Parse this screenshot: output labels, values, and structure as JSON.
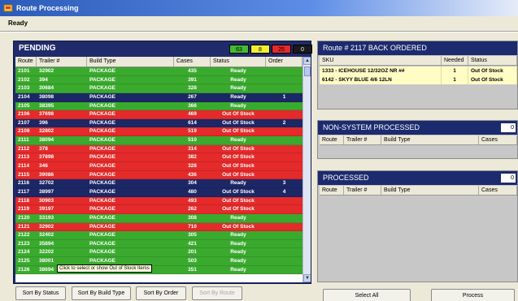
{
  "window": {
    "title": "Route Processing",
    "status": "Ready"
  },
  "pending": {
    "title": "PENDING",
    "counts": [
      {
        "value": "63",
        "color": "#44bb33"
      },
      {
        "value": "8",
        "color": "#f4ee33"
      },
      {
        "value": "25",
        "color": "#e42a2a"
      },
      {
        "value": "0",
        "color": "#1a1a1a"
      }
    ],
    "columns": {
      "route": "Route",
      "trailer": "Trailer #",
      "build": "Build Type",
      "cases": "Cases",
      "status": "Status",
      "order": "Order"
    },
    "rows": [
      {
        "route": "2101",
        "trailer": "32902",
        "build": "PACKAGE",
        "cases": "435",
        "status": "Ready",
        "order": "",
        "state": "ready"
      },
      {
        "route": "2102",
        "trailer": "394",
        "build": "PACKAGE",
        "cases": "391",
        "status": "Ready",
        "order": "",
        "state": "ready"
      },
      {
        "route": "2103",
        "trailer": "30684",
        "build": "PACKAGE",
        "cases": "328",
        "status": "Ready",
        "order": "",
        "state": "ready"
      },
      {
        "route": "2104",
        "trailer": "38098",
        "build": "PACKAGE",
        "cases": "267",
        "status": "Ready",
        "order": "1",
        "state": "sel"
      },
      {
        "route": "2105",
        "trailer": "38395",
        "build": "PACKAGE",
        "cases": "366",
        "status": "Ready",
        "order": "",
        "state": "ready"
      },
      {
        "route": "2106",
        "trailer": "37698",
        "build": "PACKAGE",
        "cases": "469",
        "status": "Out Of Stock",
        "order": "",
        "state": "out"
      },
      {
        "route": "2107",
        "trailer": "396",
        "build": "PACKAGE",
        "cases": "614",
        "status": "Out Of Stock",
        "order": "2",
        "state": "sel"
      },
      {
        "route": "2108",
        "trailer": "32802",
        "build": "PACKAGE",
        "cases": "519",
        "status": "Out Of Stock",
        "order": "",
        "state": "out"
      },
      {
        "route": "2111",
        "trailer": "38094",
        "build": "PACKAGE",
        "cases": "510",
        "status": "Ready",
        "order": "",
        "state": "ready"
      },
      {
        "route": "2112",
        "trailer": "378",
        "build": "PACKAGE",
        "cases": "314",
        "status": "Out Of Stock",
        "order": "",
        "state": "out"
      },
      {
        "route": "2113",
        "trailer": "37898",
        "build": "PACKAGE",
        "cases": "382",
        "status": "Out Of Stock",
        "order": "",
        "state": "out"
      },
      {
        "route": "2114",
        "trailer": "346",
        "build": "PACKAGE",
        "cases": "328",
        "status": "Out Of Stock",
        "order": "",
        "state": "out"
      },
      {
        "route": "2115",
        "trailer": "39086",
        "build": "PACKAGE",
        "cases": "436",
        "status": "Out Of Stock",
        "order": "",
        "state": "out"
      },
      {
        "route": "2116",
        "trailer": "32702",
        "build": "PACKAGE",
        "cases": "304",
        "status": "Ready",
        "order": "3",
        "state": "sel"
      },
      {
        "route": "2117",
        "trailer": "38997",
        "build": "PACKAGE",
        "cases": "480",
        "status": "Out Of Stock",
        "order": "4",
        "state": "sel"
      },
      {
        "route": "2118",
        "trailer": "30903",
        "build": "PACKAGE",
        "cases": "493",
        "status": "Out Of Stock",
        "order": "",
        "state": "out"
      },
      {
        "route": "2119",
        "trailer": "39197",
        "build": "PACKAGE",
        "cases": "262",
        "status": "Out Of Stock",
        "order": "",
        "state": "out"
      },
      {
        "route": "2120",
        "trailer": "33193",
        "build": "PACKAGE",
        "cases": "308",
        "status": "Ready",
        "order": "",
        "state": "ready"
      },
      {
        "route": "2121",
        "trailer": "32902",
        "build": "PACKAGE",
        "cases": "710",
        "status": "Out Of Stock",
        "order": "",
        "state": "out"
      },
      {
        "route": "2122",
        "trailer": "32402",
        "build": "PACKAGE",
        "cases": "305",
        "status": "Ready",
        "order": "",
        "state": "ready"
      },
      {
        "route": "2123",
        "trailer": "35894",
        "build": "PACKAGE",
        "cases": "421",
        "status": "Ready",
        "order": "",
        "state": "ready"
      },
      {
        "route": "2124",
        "trailer": "32202",
        "build": "PACKAGE",
        "cases": "201",
        "status": "Ready",
        "order": "",
        "state": "ready"
      },
      {
        "route": "2125",
        "trailer": "38001",
        "build": "PACKAGE",
        "cases": "503",
        "status": "Ready",
        "order": "",
        "state": "ready"
      },
      {
        "route": "2126",
        "trailer": "38694",
        "build": "PACKAGE",
        "cases": "351",
        "status": "Ready",
        "order": "",
        "state": "ready"
      }
    ],
    "tooltip": "Click to select or show Out of Stock Items",
    "buttons": {
      "sort_status": "Sort By Status",
      "sort_build": "Sort By Build Type",
      "sort_order": "Sort By Order",
      "sort_route": "Sort By Route"
    }
  },
  "backordered": {
    "title": "Route # 2117 BACK ORDERED",
    "columns": {
      "sku": "SKU",
      "needed": "Needed",
      "status": "Status"
    },
    "rows": [
      {
        "sku": "1333 - ICEHOUSE 12/32OZ NR ##",
        "needed": "1",
        "status": "Out Of Stock"
      },
      {
        "sku": "6142 - SKYY BLUE 4/6 12LN",
        "needed": "1",
        "status": "Out Of Stock"
      }
    ]
  },
  "nonsystem": {
    "title": "NON-SYSTEM PROCESSED",
    "count": "0",
    "columns": {
      "route": "Route",
      "trailer": "Trailer #",
      "build": "Build Type",
      "cases": "Cases"
    }
  },
  "processed": {
    "title": "PROCESSED",
    "count": "0",
    "columns": {
      "route": "Route",
      "trailer": "Trailer #",
      "build": "Build Type",
      "cases": "Cases"
    }
  },
  "actions": {
    "select_all": "Select All",
    "process": "Process"
  }
}
